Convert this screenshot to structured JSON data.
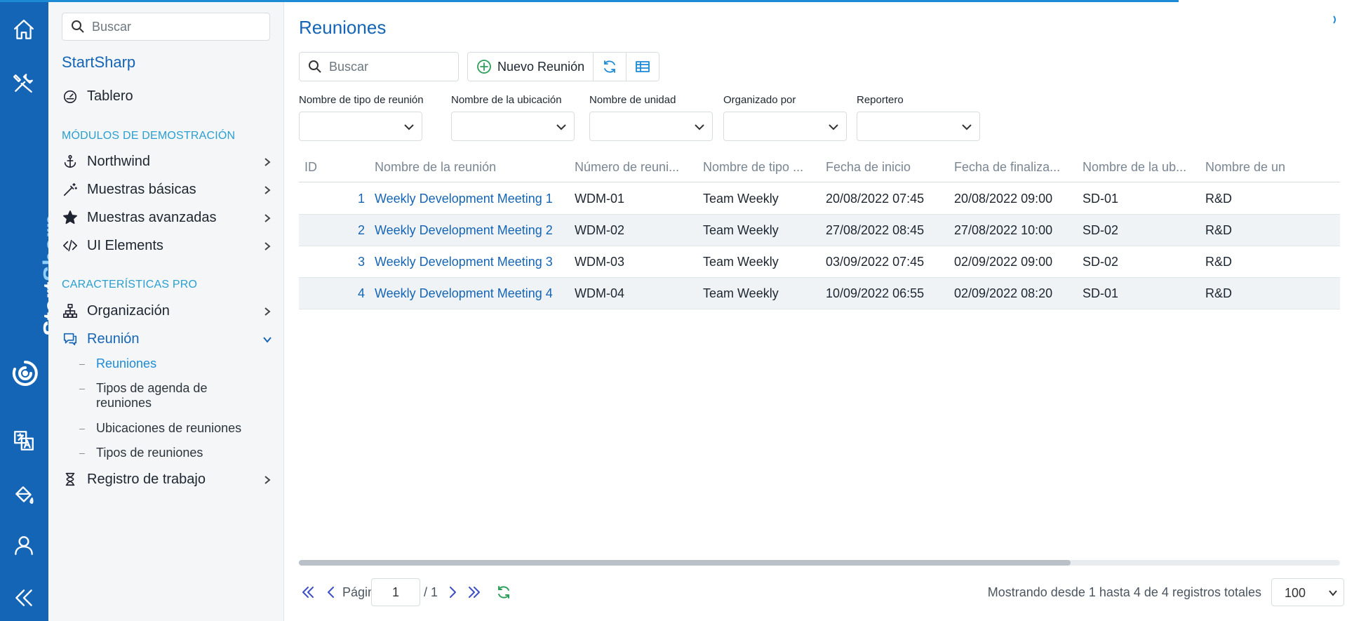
{
  "colors": {
    "brand": "#1565b6",
    "accent": "#1d8ad6",
    "section": "#2a9fd0",
    "add_icon": "#2e9e5b"
  },
  "rail": {
    "brand_vertical_start": "Start",
    "brand_vertical_end": "Sharp",
    "icons": [
      "home-icon",
      "tools-icon",
      "language-icon",
      "paint-bucket-icon",
      "user-icon",
      "collapse-icon"
    ]
  },
  "sidebar": {
    "search_placeholder": "Buscar",
    "brand": "StartSharp",
    "dashboard": "Tablero",
    "section_demo": "MÓDULOS DE DEMOSTRACIÓN",
    "demo_items": [
      {
        "label": "Northwind",
        "icon": "anchor-icon"
      },
      {
        "label": "Muestras básicas",
        "icon": "magic-wand-icon"
      },
      {
        "label": "Muestras avanzadas",
        "icon": "star-icon"
      },
      {
        "label": "UI Elements",
        "icon": "code-icon"
      }
    ],
    "section_pro": "CARACTERÍSTICAS PRO",
    "org": "Organización",
    "meeting": "Reunión",
    "meeting_sub": [
      "Reuniones",
      "Tipos de agenda de reuniones",
      "Ubicaciones de reuniones",
      "Tipos de reuniones"
    ],
    "worklog": "Registro de trabajo"
  },
  "main": {
    "title": "Reuniones",
    "search_placeholder": "Buscar",
    "new_button": "Nuevo Reunión",
    "filters": [
      "Nombre de tipo de reunión",
      "Nombre de la ubicación",
      "Nombre de unidad",
      "Organizado por",
      "Reportero"
    ]
  },
  "grid": {
    "columns": [
      "ID",
      "Nombre de la reunión",
      "Número de reuni...",
      "Nombre de tipo ...",
      "Fecha de inicio",
      "Fecha de finaliza...",
      "Nombre de la ub...",
      "Nombre de un"
    ],
    "rows": [
      [
        "1",
        "Weekly Development Meeting 1",
        "WDM-01",
        "Team Weekly",
        "20/08/2022 07:45",
        "20/08/2022 09:00",
        "SD-01",
        "R&D"
      ],
      [
        "2",
        "Weekly Development Meeting 2",
        "WDM-02",
        "Team Weekly",
        "27/08/2022 08:45",
        "27/08/2022 10:00",
        "SD-02",
        "R&D"
      ],
      [
        "3",
        "Weekly Development Meeting 3",
        "WDM-03",
        "Team Weekly",
        "03/09/2022 07:45",
        "02/09/2022 09:00",
        "SD-02",
        "R&D"
      ],
      [
        "4",
        "Weekly Development Meeting 4",
        "WDM-04",
        "Team Weekly",
        "10/09/2022 06:55",
        "02/09/2022 08:20",
        "SD-01",
        "R&D"
      ]
    ]
  },
  "pager": {
    "page_label": "Página",
    "page_value": "1",
    "page_total": "/ 1",
    "status": "Mostrando desde 1 hasta 4 de 4 registros totales",
    "page_size": "100"
  }
}
